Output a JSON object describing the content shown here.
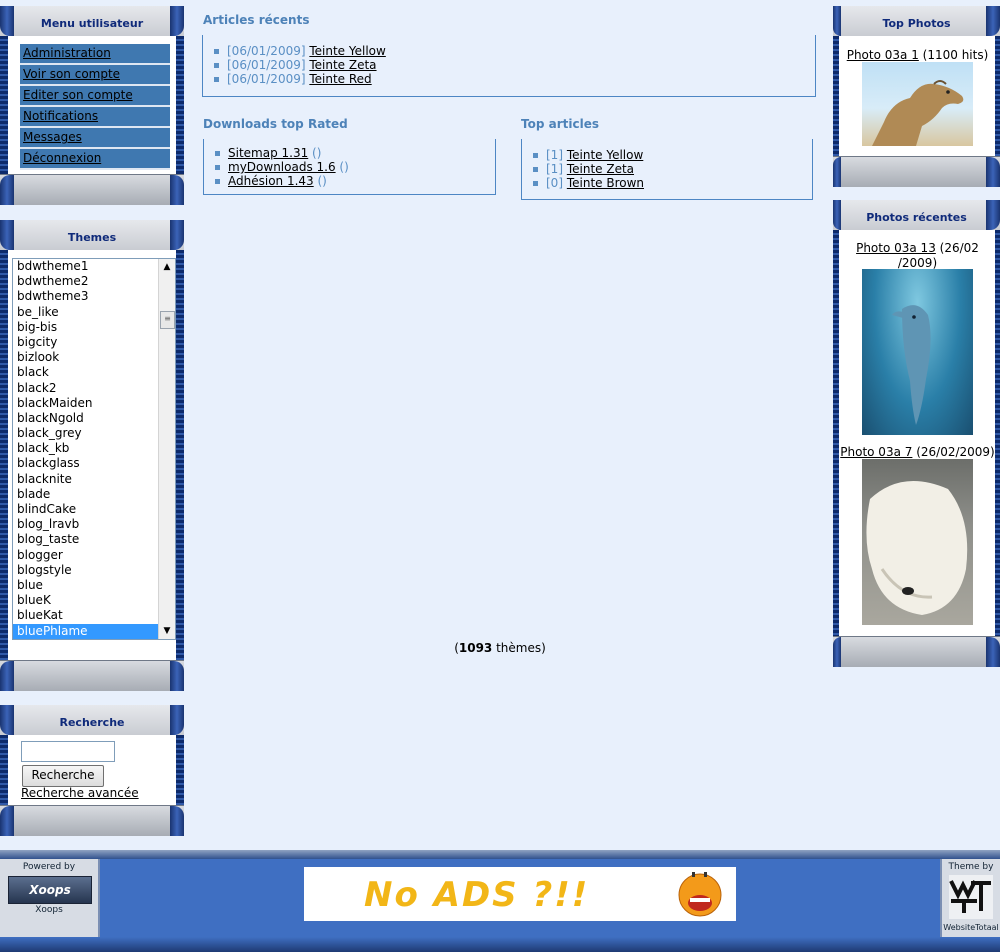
{
  "user_menu": {
    "title": "Menu utilisateur",
    "items": [
      "Administration",
      "Voir son compte",
      "Editer son compte",
      "Notifications",
      "Messages",
      "Déconnexion"
    ]
  },
  "themes": {
    "title": "Themes",
    "options": [
      "bdwtheme1",
      "bdwtheme2",
      "bdwtheme3",
      "be_like",
      "big-bis",
      "bigcity",
      "bizlook",
      "black",
      "black2",
      "blackMaiden",
      "blackNgold",
      "black_grey",
      "black_kb",
      "blackglass",
      "blacknite",
      "blade",
      "blindCake",
      "blog_lravb",
      "blog_taste",
      "blogger",
      "blogstyle",
      "blue",
      "blueK",
      "blueKat",
      "bluePhlame"
    ],
    "selected": "bluePhlame",
    "count_prefix": "(",
    "count_value": "1093",
    "count_suffix": " thèmes)"
  },
  "search": {
    "title": "Recherche",
    "input_value": "",
    "button_label": "Recherche",
    "advanced_label": "Recherche avancée"
  },
  "recent_articles": {
    "title": "Articles récents",
    "items": [
      {
        "date": "[06/01/2009]",
        "title": "Teinte Yellow"
      },
      {
        "date": "[06/01/2009]",
        "title": "Teinte Zeta"
      },
      {
        "date": "[06/01/2009]",
        "title": "Teinte Red"
      }
    ]
  },
  "downloads": {
    "title": "Downloads top Rated",
    "items": [
      {
        "title": "Sitemap 1.31",
        "meta": " ()"
      },
      {
        "title": "myDownloads 1.6",
        "meta": " ()"
      },
      {
        "title": "Adhésion 1.43",
        "meta": " ()"
      }
    ]
  },
  "top_articles": {
    "title": "Top articles",
    "items": [
      {
        "count": "[1]",
        "title": "Teinte Yellow"
      },
      {
        "count": "[1]",
        "title": "Teinte Zeta"
      },
      {
        "count": "[0]",
        "title": "Teinte Brown"
      }
    ]
  },
  "top_photos": {
    "title": "Top Photos",
    "photo": {
      "title": "Photo 03a 1",
      "meta": " (1100 hits)"
    }
  },
  "recent_photos": {
    "title": "Photos récentes",
    "photos": [
      {
        "title": "Photo 03a 13",
        "meta_line1": " (26/02",
        "meta_line2": "/2009)"
      },
      {
        "title": "Photo 03a 7",
        "meta": " (26/02/2009)"
      }
    ]
  },
  "footer": {
    "powered_by": "Powered by",
    "xoops_logo": "Xoops",
    "xoops_caption": "Xoops",
    "banner_text": "No ADS ?!!",
    "theme_by": "Theme by",
    "wt_caption": "WebsiteTotaal"
  }
}
